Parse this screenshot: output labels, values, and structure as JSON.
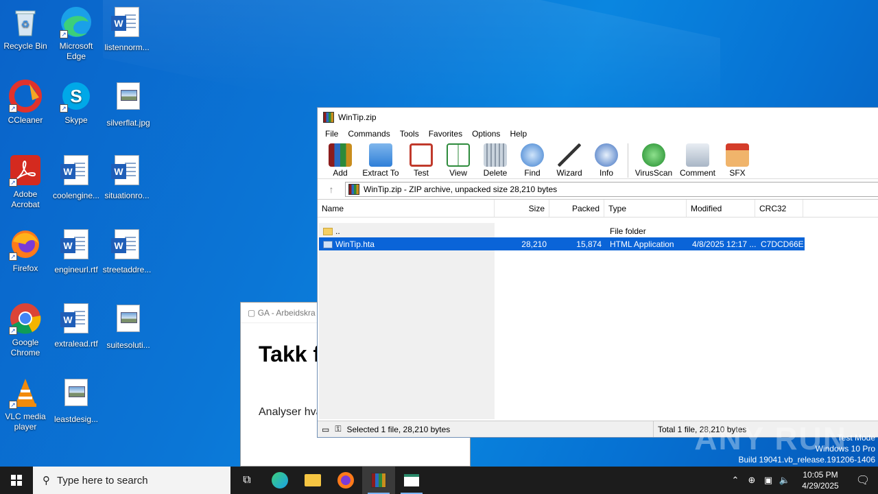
{
  "desktop": {
    "icons": [
      {
        "label": "Recycle Bin"
      },
      {
        "label": "Microsoft Edge"
      },
      {
        "label": "listennorm..."
      },
      {
        "label": "CCleaner"
      },
      {
        "label": "Skype"
      },
      {
        "label": "silverflat.jpg"
      },
      {
        "label": "Adobe Acrobat"
      },
      {
        "label": "coolengine..."
      },
      {
        "label": "situationro..."
      },
      {
        "label": "Firefox"
      },
      {
        "label": "engineurl.rtf"
      },
      {
        "label": "streetaddre..."
      },
      {
        "label": "Google Chrome"
      },
      {
        "label": "extralead.rtf"
      },
      {
        "label": "suitesoluti..."
      },
      {
        "label": "VLC media player"
      },
      {
        "label": "leastdesig..."
      }
    ]
  },
  "bg_window": {
    "title": "GA - Arbeidskra",
    "heading": "Takk f ventet",
    "text": "Analyser hva egentlig kjør"
  },
  "winrar": {
    "title": "WinTip.zip",
    "menu": [
      "File",
      "Commands",
      "Tools",
      "Favorites",
      "Options",
      "Help"
    ],
    "toolbar": [
      "Add",
      "Extract To",
      "Test",
      "View",
      "Delete",
      "Find",
      "Wizard",
      "Info",
      "VirusScan",
      "Comment",
      "SFX"
    ],
    "path": "WinTip.zip - ZIP archive, unpacked size 28,210 bytes",
    "columns": {
      "name": "Name",
      "size": "Size",
      "packed": "Packed",
      "type": "Type",
      "modified": "Modified",
      "crc": "CRC32"
    },
    "rows": [
      {
        "name": "..",
        "size": "",
        "packed": "",
        "type": "File folder",
        "modified": "",
        "crc": ""
      },
      {
        "name": "WinTip.hta",
        "size": "28,210",
        "packed": "15,874",
        "type": "HTML Application",
        "modified": "4/8/2025 12:17 ...",
        "crc": "C7DCD66E"
      }
    ],
    "status_left": "Selected 1 file, 28,210 bytes",
    "status_right": "Total 1 file, 28,210 bytes"
  },
  "watermark": "ANY RUN",
  "windows_info": {
    "line1": "Test Mode",
    "line2": "Windows 10 Pro",
    "line3": "Build 19041.vb_release.191206-1406"
  },
  "taskbar": {
    "search_placeholder": "Type here to search",
    "time": "10:05 PM",
    "date": "4/29/2025"
  }
}
